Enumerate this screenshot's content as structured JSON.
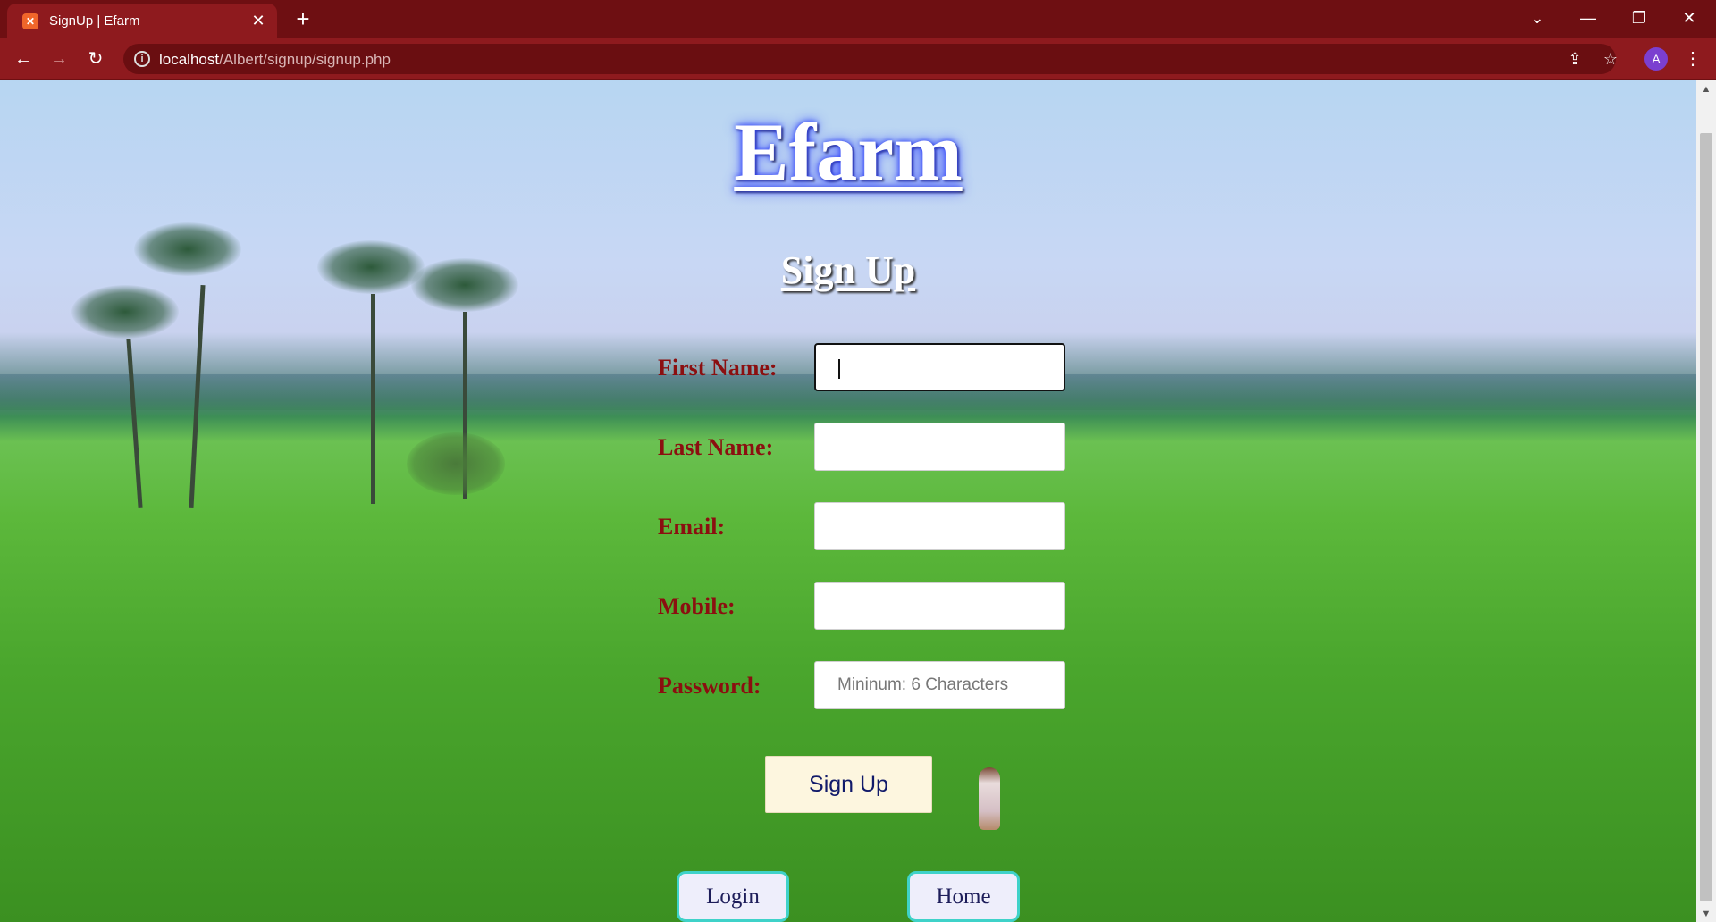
{
  "browser": {
    "tab_title": "SignUp | Efarm",
    "tab_favicon": "xampp-icon",
    "url_host": "localhost",
    "url_path": "/Albert/signup/signup.php",
    "profile_initial": "A",
    "colors": {
      "tab_strip": "#6e0f12",
      "toolbar": "#8e1a1e"
    }
  },
  "page": {
    "brand": "Efarm",
    "title": "Sign Up",
    "fields": [
      {
        "label": "First Name:",
        "value": "",
        "placeholder": ""
      },
      {
        "label": "Last Name:",
        "value": "",
        "placeholder": ""
      },
      {
        "label": "Email:",
        "value": "",
        "placeholder": ""
      },
      {
        "label": "Mobile:",
        "value": "",
        "placeholder": ""
      },
      {
        "label": "Password:",
        "value": "",
        "placeholder": "Mininum: 6 Characters"
      }
    ],
    "submit_label": "Sign Up",
    "links": {
      "login": "Login",
      "home": "Home"
    },
    "colors": {
      "label": "#8b0f10",
      "brand_glow": "#3a4cff",
      "link_border": "#3fd2c9"
    }
  }
}
